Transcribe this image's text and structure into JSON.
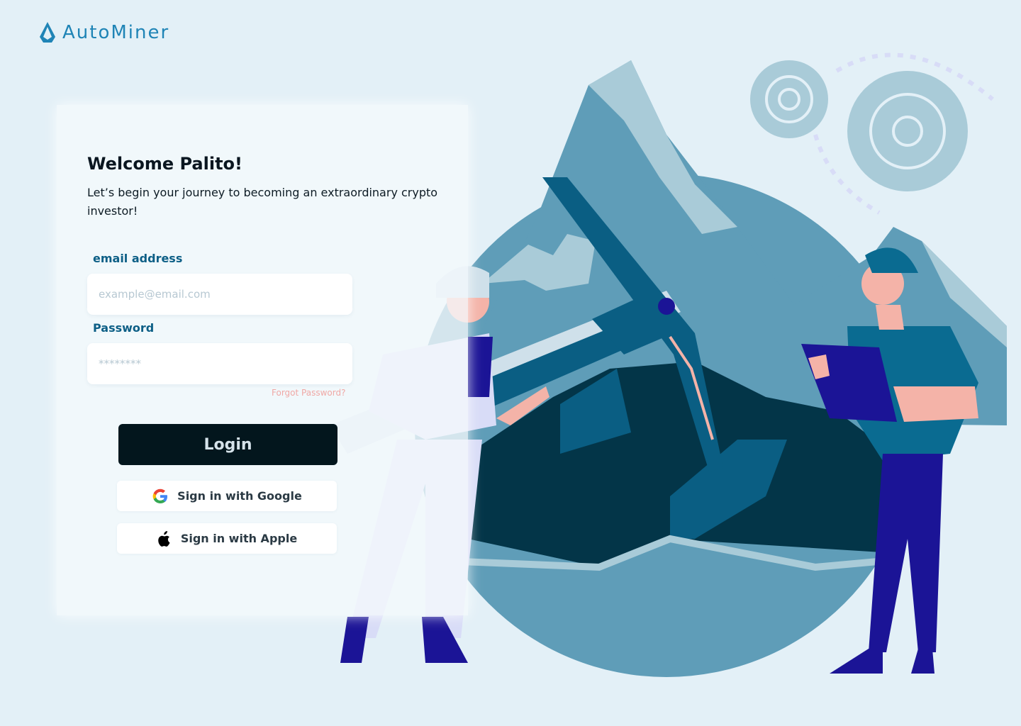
{
  "brand": {
    "name": "AutoMiner",
    "logo_icon": "diamond-drop-icon",
    "color": "#1f84b6"
  },
  "login": {
    "title": "Welcome Palito!",
    "subtitle": "Let’s begin your journey to becoming an extraordinary crypto investor!",
    "email_label": "email address",
    "email_placeholder": "example@email.com",
    "email_value": "",
    "password_label": "Password",
    "password_placeholder": "********",
    "password_value": "",
    "forgot_label": "Forgot Password?",
    "login_label": "Login",
    "google_label": "Sign in with Google",
    "google_icon": "google-icon",
    "apple_label": "Sign in with Apple",
    "apple_icon": "apple-icon"
  },
  "colors": {
    "background": "#e3f0f7",
    "primary_button": "#03161d",
    "label": "#0d5f86",
    "forgot_link": "#f0a8a5",
    "mountain": "#5f9db8",
    "miner_pants": "#1b1496"
  },
  "illustration": {
    "subject": "miners-with-pickaxe-and-gears"
  }
}
